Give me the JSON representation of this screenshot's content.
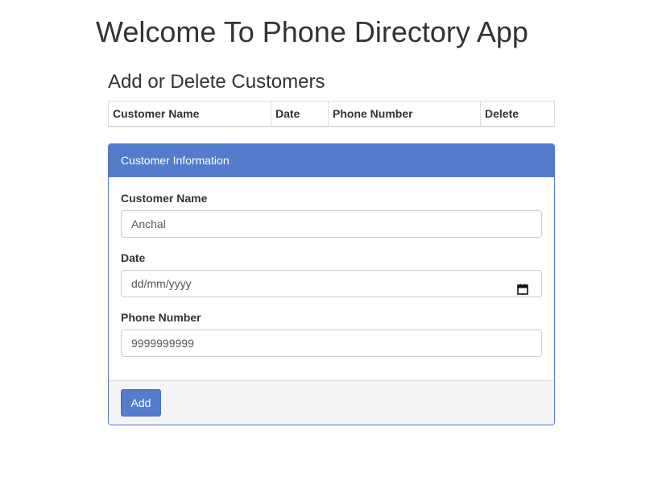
{
  "header": {
    "title": "Welcome To Phone Directory App"
  },
  "section": {
    "title": "Add or Delete Customers"
  },
  "table": {
    "columns": [
      "Customer Name",
      "Date",
      "Phone Number",
      "Delete"
    ]
  },
  "panel": {
    "title": "Customer Information",
    "fields": {
      "name": {
        "label": "Customer Name",
        "value": "Anchal"
      },
      "date": {
        "label": "Date",
        "placeholder": "dd/mm/yyyy",
        "icon": "calendar-icon"
      },
      "phone": {
        "label": "Phone Number",
        "value": "9999999999"
      }
    },
    "add_label": "Add"
  },
  "colors": {
    "accent": "#557bcd",
    "text": "#333333",
    "footer_bg": "#f5f5f5"
  }
}
